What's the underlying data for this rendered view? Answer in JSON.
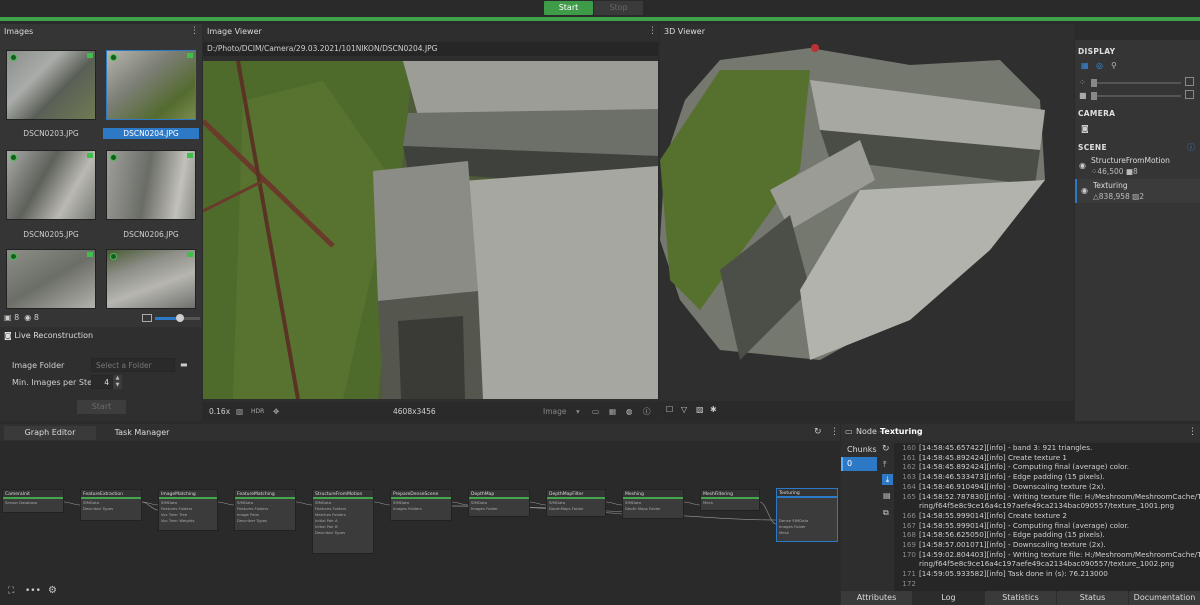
{
  "toolbar": {
    "start_label": "Start",
    "stop_label": "Stop"
  },
  "images_panel": {
    "title": "Images",
    "thumbnails": [
      {
        "label": "DSCN0203.JPG",
        "selected": false
      },
      {
        "label": "DSCN0204.JPG",
        "selected": true
      },
      {
        "label": "DSCN0205.JPG",
        "selected": false
      },
      {
        "label": "DSCN0206.JPG",
        "selected": false
      },
      {
        "label": "",
        "selected": false
      },
      {
        "label": "",
        "selected": false
      }
    ],
    "count_images": "8",
    "count_cameras": "8",
    "thumb_size_fraction": 0.55
  },
  "live_reconstruction": {
    "title": "Live Reconstruction",
    "image_folder_label": "Image Folder",
    "image_folder_placeholder": "Select a Folder",
    "min_images_label": "Min. Images per Step",
    "min_images_value": "4",
    "start_label": "Start"
  },
  "image_viewer": {
    "title": "Image Viewer",
    "path": "D:/Photo/DCIM/Camera/29.03.2021/101NIKON/DSCN0204.JPG",
    "zoom": "0.16x",
    "hdr_label": "HDR",
    "resolution": "4608x3456",
    "mode_label": "Image"
  },
  "viewer_3d": {
    "title": "3D Viewer"
  },
  "display_panel": {
    "display_title": "DISPLAY",
    "camera_title": "CAMERA",
    "scene_title": "SCENE",
    "scene_items": [
      {
        "name": "StructureFromMotion",
        "stat1": "46,500",
        "stat2": "8"
      },
      {
        "name": "Texturing",
        "stat1": "838,958",
        "stat2": "2"
      }
    ]
  },
  "graph_editor": {
    "tabs": [
      {
        "label": "Graph Editor"
      },
      {
        "label": "Task Manager"
      }
    ],
    "nodes": [
      {
        "title": "CameraInit",
        "rows": [
          "Sensor Database"
        ]
      },
      {
        "title": "FeatureExtraction",
        "rows": [
          "SfMData",
          "Describer Types"
        ]
      },
      {
        "title": "ImageMatching",
        "rows": [
          "SfMData",
          "Features Folders",
          "Voc Tree: Tree",
          "Voc Tree: Weights"
        ]
      },
      {
        "title": "FeatureMatching",
        "rows": [
          "SfMData",
          "Features Folders",
          "Image Pairs",
          "Describer Types"
        ]
      },
      {
        "title": "StructureFromMotion",
        "rows": [
          "SfMData",
          "Features Folders",
          "Matches Folders",
          "Initial Pair A",
          "Initial Pair B",
          "Describer Types"
        ]
      },
      {
        "title": "PrepareDenseScene",
        "rows": [
          "SfMData",
          "Images Folders"
        ]
      },
      {
        "title": "DepthMap",
        "rows": [
          "SfMData",
          "Images Folder"
        ]
      },
      {
        "title": "DepthMapFilter",
        "rows": [
          "SfMData",
          "DepthMaps Folder"
        ]
      },
      {
        "title": "Meshing",
        "rows": [
          "SfMData",
          "Depth Maps Folder"
        ]
      },
      {
        "title": "MeshFiltering",
        "rows": [
          "Mesh"
        ]
      },
      {
        "title": "Texturing",
        "rows": [
          "Dense SfMData",
          "Images Folder",
          "Mesh"
        ]
      }
    ]
  },
  "node_panel": {
    "prefix": "Node -",
    "node_name": "Texturing",
    "chunks_label": "Chunks",
    "chunk_index": "0",
    "log_lines": [
      {
        "num": "160",
        "text": "[14:58:45.657422][info]      - band 3: 921 triangles."
      },
      {
        "num": "161",
        "text": "[14:58:45.892424][info] Create texture 1"
      },
      {
        "num": "162",
        "text": "[14:58:45.892424][info]   - Computing final (average) color."
      },
      {
        "num": "163",
        "text": "[14:58:46.533473][info]   - Edge padding (15 pixels)."
      },
      {
        "num": "164",
        "text": "[14:58:46.910494][info]   - Downscaling texture (2x)."
      },
      {
        "num": "165",
        "text": "[14:58:52.787830][info]   - Writing texture file: H:/Meshroom/MeshroomCache/Textu"
      },
      {
        "num": "",
        "text": "ring/f64f5e8c9ce16a4c197aefe49ca2134bac090557/texture_1001.png"
      },
      {
        "num": "166",
        "text": "[14:58:55.999014][info] Create texture 2"
      },
      {
        "num": "167",
        "text": "[14:58:55.999014][info]   - Computing final (average) color."
      },
      {
        "num": "168",
        "text": "[14:58:56.625050][info]   - Edge padding (15 pixels)."
      },
      {
        "num": "169",
        "text": "[14:58:57.001071][info]   - Downscaling texture (2x)."
      },
      {
        "num": "170",
        "text": "[14:59:02.804403][info]   - Writing texture file: H:/Meshroom/MeshroomCache/Textu"
      },
      {
        "num": "",
        "text": "ring/f64f5e8c9ce16a4c197aefe49ca2134bac090557/texture_1002.png"
      },
      {
        "num": "171",
        "text": "[14:59:05.933582][info] Task done in (s): 76.213000"
      },
      {
        "num": "172",
        "text": ""
      }
    ],
    "bottom_tabs": [
      {
        "label": "Attributes"
      },
      {
        "label": "Log"
      },
      {
        "label": "Statistics"
      },
      {
        "label": "Status"
      },
      {
        "label": "Documentation"
      }
    ]
  },
  "colors": {
    "accent_green": "#3fa14a",
    "selection_blue": "#2e79c6"
  }
}
